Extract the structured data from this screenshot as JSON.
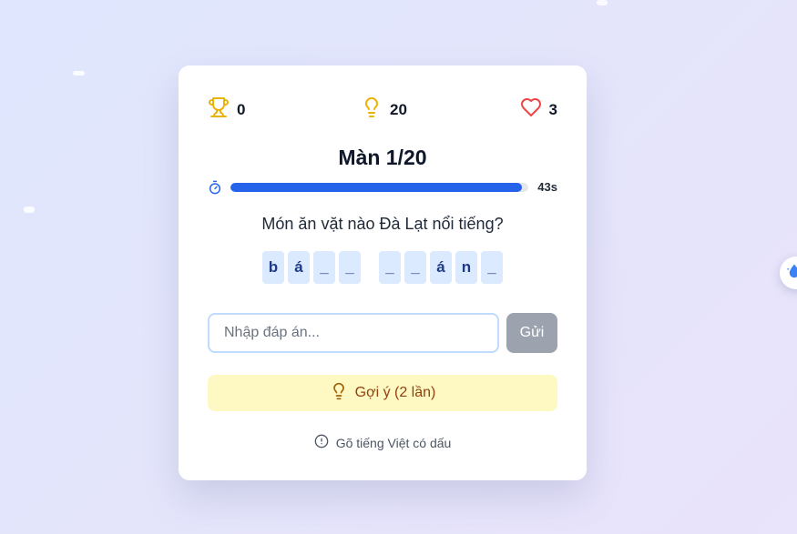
{
  "stats": {
    "score": "0",
    "hints": "20",
    "lives": "3"
  },
  "level": {
    "title": "Màn 1/20"
  },
  "timer": {
    "text": "43s",
    "progress": 0.98
  },
  "question": {
    "text": "Món ăn vặt nào Đà Lạt nổi tiếng?"
  },
  "tiles": [
    "b",
    "á",
    "_",
    "_",
    " ",
    "_",
    "_",
    "á",
    "n",
    "_"
  ],
  "answer": {
    "placeholder": "Nhập đáp án...",
    "value": ""
  },
  "submit": {
    "label": "Gửi"
  },
  "hint": {
    "label": "Gợi ý (2 lần)"
  },
  "note": {
    "text": "Gõ tiếng Việt có dấu"
  },
  "colors": {
    "accent": "#2563eb",
    "trophy": "#eab308",
    "heart": "#ef4444",
    "hint_bg": "#fef9c3"
  },
  "icons": [
    "trophy-icon",
    "lightbulb-icon",
    "heart-icon",
    "stopwatch-icon",
    "alert-circle-icon",
    "water-drop-icon"
  ]
}
